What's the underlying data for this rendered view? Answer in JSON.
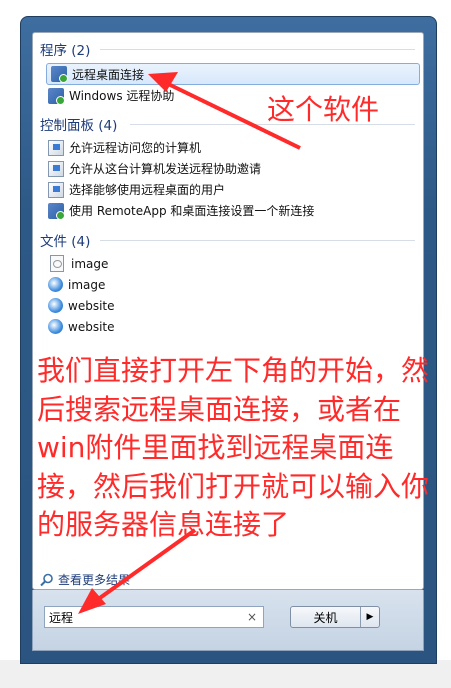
{
  "sections": {
    "programs": {
      "header": "程序 (2)",
      "items": [
        {
          "label": "远程桌面连接",
          "icon": "remote-desktop-icon",
          "selected": true
        },
        {
          "label": "Windows 远程协助",
          "icon": "remote-assistance-icon",
          "selected": false
        }
      ]
    },
    "control_panel": {
      "header": "控制面板 (4)",
      "items": [
        {
          "label": "允许远程访问您的计算机",
          "icon": "control-panel-icon"
        },
        {
          "label": "允许从这台计算机发送远程协助邀请",
          "icon": "control-panel-icon"
        },
        {
          "label": "选择能够使用远程桌面的用户",
          "icon": "control-panel-icon"
        },
        {
          "label": "使用 RemoteApp 和桌面连接设置一个新连接",
          "icon": "remoteapp-icon"
        }
      ]
    },
    "files": {
      "header": "文件 (4)",
      "items": [
        {
          "label": "image",
          "icon": "file-icon"
        },
        {
          "label": "image",
          "icon": "web-document-icon"
        },
        {
          "label": "website",
          "icon": "web-document-icon"
        },
        {
          "label": "website",
          "icon": "web-document-icon"
        }
      ]
    }
  },
  "see_more": "查看更多结果",
  "search": {
    "value": "远程",
    "clear": "×"
  },
  "shutdown": {
    "label": "关机",
    "arrow": "▶"
  },
  "annotations": {
    "top": "这个软件",
    "main": "我们直接打开左下角的开始，然后搜索远程桌面连接，或者在win附件里面找到远程桌面连接，然后我们打开就可以输入你的服务器信息连接了",
    "color": "#ff2a2a"
  }
}
